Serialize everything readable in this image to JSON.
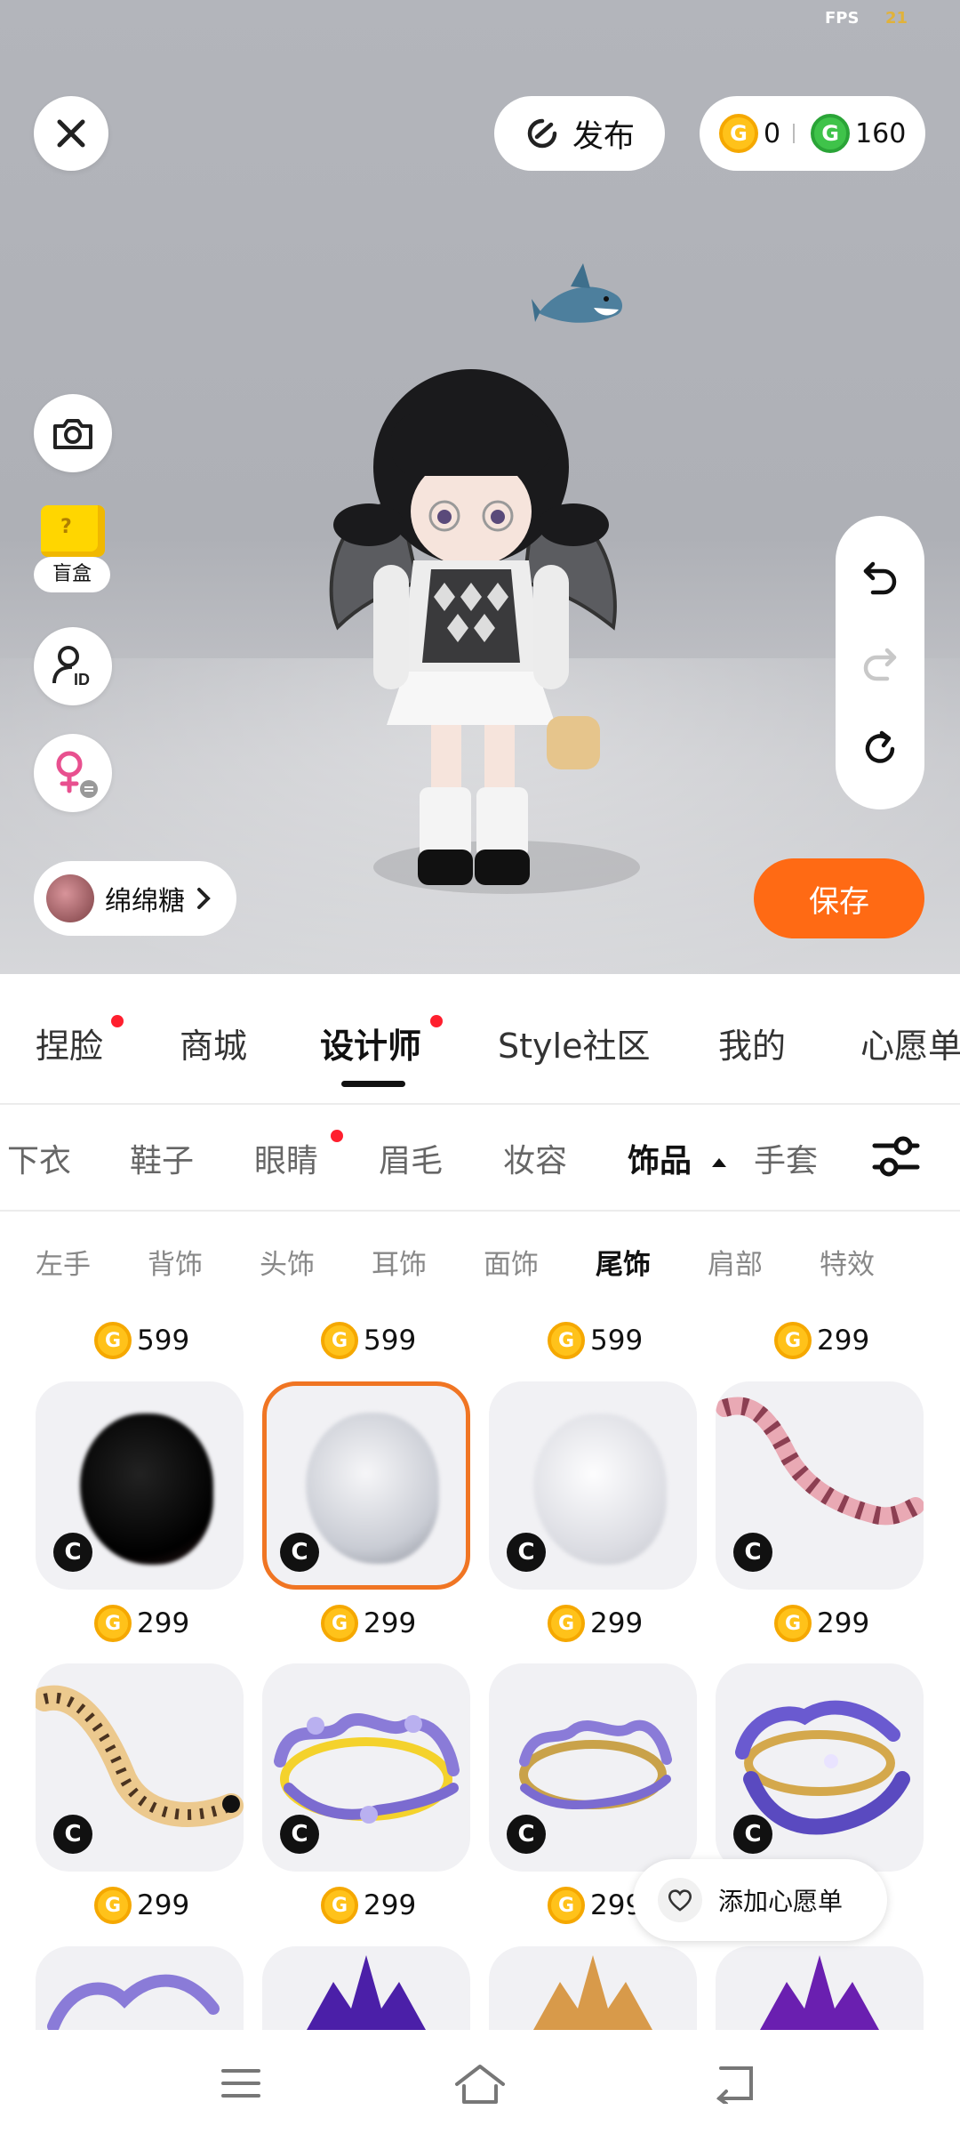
{
  "status": {
    "fps_label": "FPS",
    "fps_value": "21"
  },
  "top_bar": {
    "publish_label": "发布",
    "gold_coin_symbol": "G",
    "gold_balance": "0",
    "green_coin_symbol": "G",
    "green_balance": "160"
  },
  "side_tools": {
    "blind_box_label": "盲盒",
    "blind_box_symbol": "?",
    "avatar_id_icon": "avatar-id-icon",
    "gender_icon": "female-swap-icon"
  },
  "profile": {
    "name": "绵绵糖"
  },
  "save_label": "保存",
  "main_tabs": [
    {
      "label": "捏脸",
      "badge": true
    },
    {
      "label": "商城",
      "badge": false
    },
    {
      "label": "设计师",
      "badge": true,
      "active": true
    },
    {
      "label": "Style社区",
      "badge": false
    },
    {
      "label": "我的",
      "badge": false
    },
    {
      "label": "心愿单",
      "badge": false
    }
  ],
  "category_tabs": [
    {
      "label": "下衣"
    },
    {
      "label": "鞋子"
    },
    {
      "label": "眼睛",
      "badge": true
    },
    {
      "label": "眉毛"
    },
    {
      "label": "妆容"
    },
    {
      "label": "饰品",
      "active": true,
      "expanded": true
    },
    {
      "label": "手套"
    }
  ],
  "sub_tabs": [
    {
      "label": "左手"
    },
    {
      "label": "背饰"
    },
    {
      "label": "头饰"
    },
    {
      "label": "耳饰"
    },
    {
      "label": "面饰"
    },
    {
      "label": "尾饰",
      "active": true
    },
    {
      "label": "肩部"
    },
    {
      "label": "特效"
    }
  ],
  "top_prices": [
    "599",
    "599",
    "599",
    "299"
  ],
  "creator_badge": "C",
  "items": [
    {
      "name": "black fluffy tail",
      "price": "299"
    },
    {
      "name": "white fluffy tail",
      "price": "299",
      "selected": true
    },
    {
      "name": "white translucent tail",
      "price": "299"
    },
    {
      "name": "pink striped tail",
      "price": "299"
    },
    {
      "name": "leopard tail",
      "price": "299"
    },
    {
      "name": "purple floral halo yellow",
      "price": "299"
    },
    {
      "name": "purple floral halo gold",
      "price": "299"
    },
    {
      "name": "purple floral halo blue",
      "price": "299"
    }
  ],
  "wishlist_label": "添加心愿单",
  "colors": {
    "accent": "#ff6a14",
    "selected_border": "#f07523",
    "badge_red": "#ff1f2e",
    "coin_gold": "#ffc21a",
    "coin_green": "#3fc34a"
  }
}
